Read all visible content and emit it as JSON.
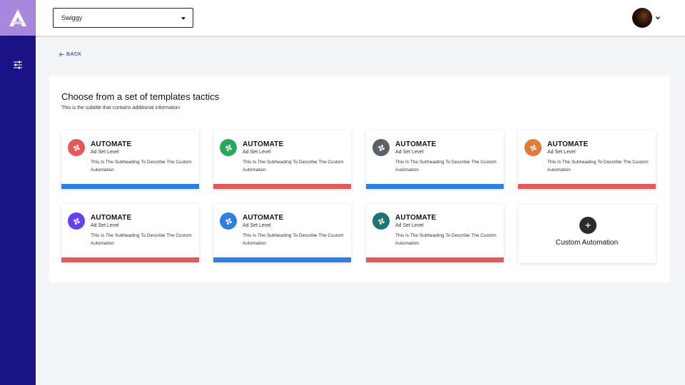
{
  "header": {
    "account_select": {
      "value": "Swiggy"
    }
  },
  "back_label": "BACK",
  "panel": {
    "title": "Choose from a set of templates tactics",
    "subtitle": "This is the subtitle that contains additional information"
  },
  "cards": [
    {
      "title": "AUTOMATE",
      "level": "Ad Set Level",
      "description": "This Is The Subheading To Describe The Custom Automation",
      "icon_color": "#e25a5a",
      "bar_color": "#2f7fe3"
    },
    {
      "title": "AUTOMATE",
      "level": "Ad Set Level",
      "description": "This Is The Subheading To Describe The Custom Automation",
      "icon_color": "#27a85d",
      "bar_color": "#e25a5a"
    },
    {
      "title": "AUTOMATE",
      "level": "Ad Set Level",
      "description": "This Is The Subheading To Describe The Custom Automation",
      "icon_color": "#5a6268",
      "bar_color": "#2f7fe3"
    },
    {
      "title": "AUTOMATE",
      "level": "Ad Set Level",
      "description": "This Is The Subheading To Describe The Custom Automation",
      "icon_color": "#e07b39",
      "bar_color": "#e25a5a"
    },
    {
      "title": "AUTOMATE",
      "level": "Ad Set Level",
      "description": "This Is The Subheading To Describe The Custom Automation",
      "icon_color": "#6a3ef2",
      "bar_color": "#e25a5a"
    },
    {
      "title": "AUTOMATE",
      "level": "Ad Set Level",
      "description": "This Is The Subheading To Describe The Custom Automation",
      "icon_color": "#2f7fe3",
      "bar_color": "#2f7fe3"
    },
    {
      "title": "AUTOMATE",
      "level": "Ad Set Level",
      "description": "This Is The Subheading To Describe The Custom Automation",
      "icon_color": "#1f7275",
      "bar_color": "#e25a5a"
    }
  ],
  "custom_card": {
    "label": "Custom Automation",
    "icon": "plus-icon"
  },
  "icons": {
    "logo": "logo-icon",
    "sidebar": "filter-icon",
    "card": "pinwheel-icon",
    "dropdown": "chevron-down-icon",
    "back": "arrow-left-icon"
  },
  "colors": {
    "sidebar": "#1b1486",
    "logo_bg": "#a888dd",
    "link": "#4a5bd4",
    "bar_blue": "#2f7fe3",
    "bar_red": "#e25a5a"
  }
}
